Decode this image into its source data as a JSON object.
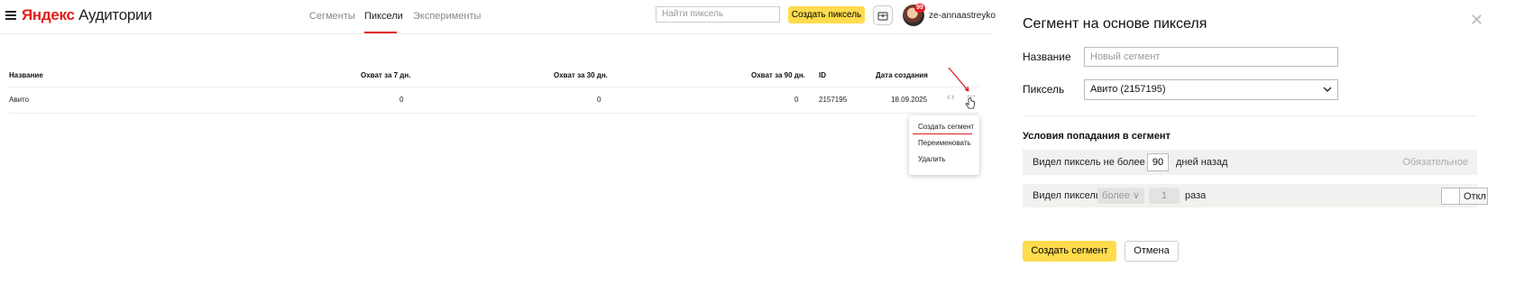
{
  "app": {
    "logo_brand": "Яндекс",
    "logo_product": "Аудитории"
  },
  "nav": {
    "tabs": [
      {
        "label": "Сегменты",
        "active": false
      },
      {
        "label": "Пиксели",
        "active": true
      },
      {
        "label": "Эксперименты",
        "active": false
      }
    ]
  },
  "header": {
    "search_placeholder": "Найти пиксель",
    "create_pixel_label": "Создать пиксель",
    "notification_count": "99",
    "username": "ze-annaastreyko"
  },
  "table": {
    "columns": [
      "Название",
      "Охват за 7 дн.",
      "Охват за 30 дн.",
      "Охват за 90 дн.",
      "ID",
      "Дата создания"
    ],
    "rows": [
      {
        "name": "Авито",
        "reach7": "0",
        "reach30": "0",
        "reach90": "0",
        "id": "2157195",
        "created": "18.09.2025"
      }
    ]
  },
  "context_menu": {
    "items": [
      "Создать сегмент",
      "Переименовать",
      "Удалить"
    ]
  },
  "panel": {
    "title": "Сегмент на основе пикселя",
    "name_label": "Название",
    "name_placeholder": "Новый сегмент",
    "pixel_label": "Пиксель",
    "pixel_value": "Авито (2157195)",
    "conditions_title": "Условия попадания в сегмент",
    "cond1_prefix": "Видел пиксель не более",
    "cond1_days": "90",
    "cond1_suffix": "дней назад",
    "cond1_required": "Обязательное",
    "cond2_prefix": "Видел пиксель",
    "cond2_operator": "более",
    "cond2_count": "1",
    "cond2_suffix": "раза",
    "cond2_toggle": "Откл",
    "create_label": "Создать сегмент",
    "cancel_label": "Отмена"
  },
  "colors": {
    "accent_yellow": "#ffdb4d",
    "brand_red": "#e11b22",
    "condition_bg": "#f2f1ef"
  }
}
